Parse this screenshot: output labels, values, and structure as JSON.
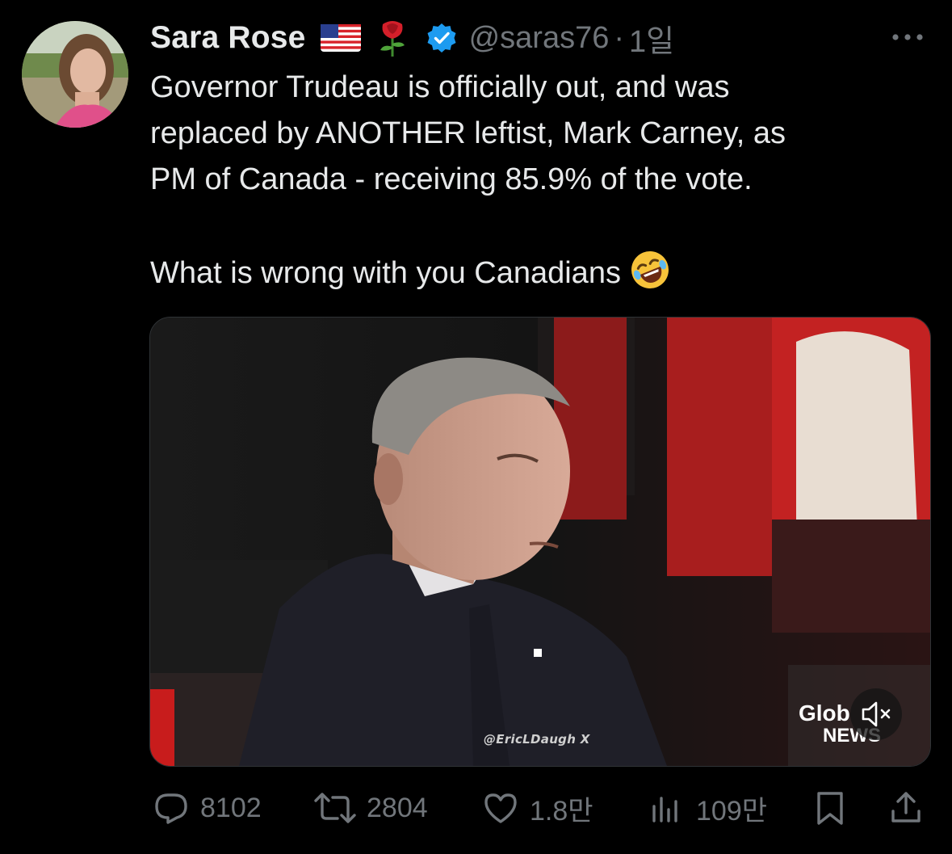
{
  "tweet": {
    "author": {
      "display_name": "Sara Rose",
      "handle": "@saras76",
      "verified": true,
      "badges": [
        "us-flag-icon",
        "rose-icon",
        "verified-badge-icon"
      ]
    },
    "separator": "·",
    "time": "1일",
    "text_lines": [
      "Governor Trudeau is officially out, and was",
      "replaced by ANOTHER leftist, Mark Carney, as",
      "PM of Canada - receiving 85.9% of the vote.",
      "What is wrong with you Canadians"
    ],
    "trailing_emoji": "rolling-on-floor-laughing-icon",
    "media": {
      "type": "video",
      "watermark": "@EricLDaugh X",
      "logo_line1": "Glob",
      "logo_line2": "NEWS",
      "muted": true
    },
    "metrics": {
      "replies": "8102",
      "reposts": "2804",
      "likes": "1.8만",
      "views": "109만"
    }
  },
  "colors": {
    "background": "#000000",
    "text": "#e7e9ea",
    "muted": "#71767b",
    "verified": "#1d9bf0"
  }
}
